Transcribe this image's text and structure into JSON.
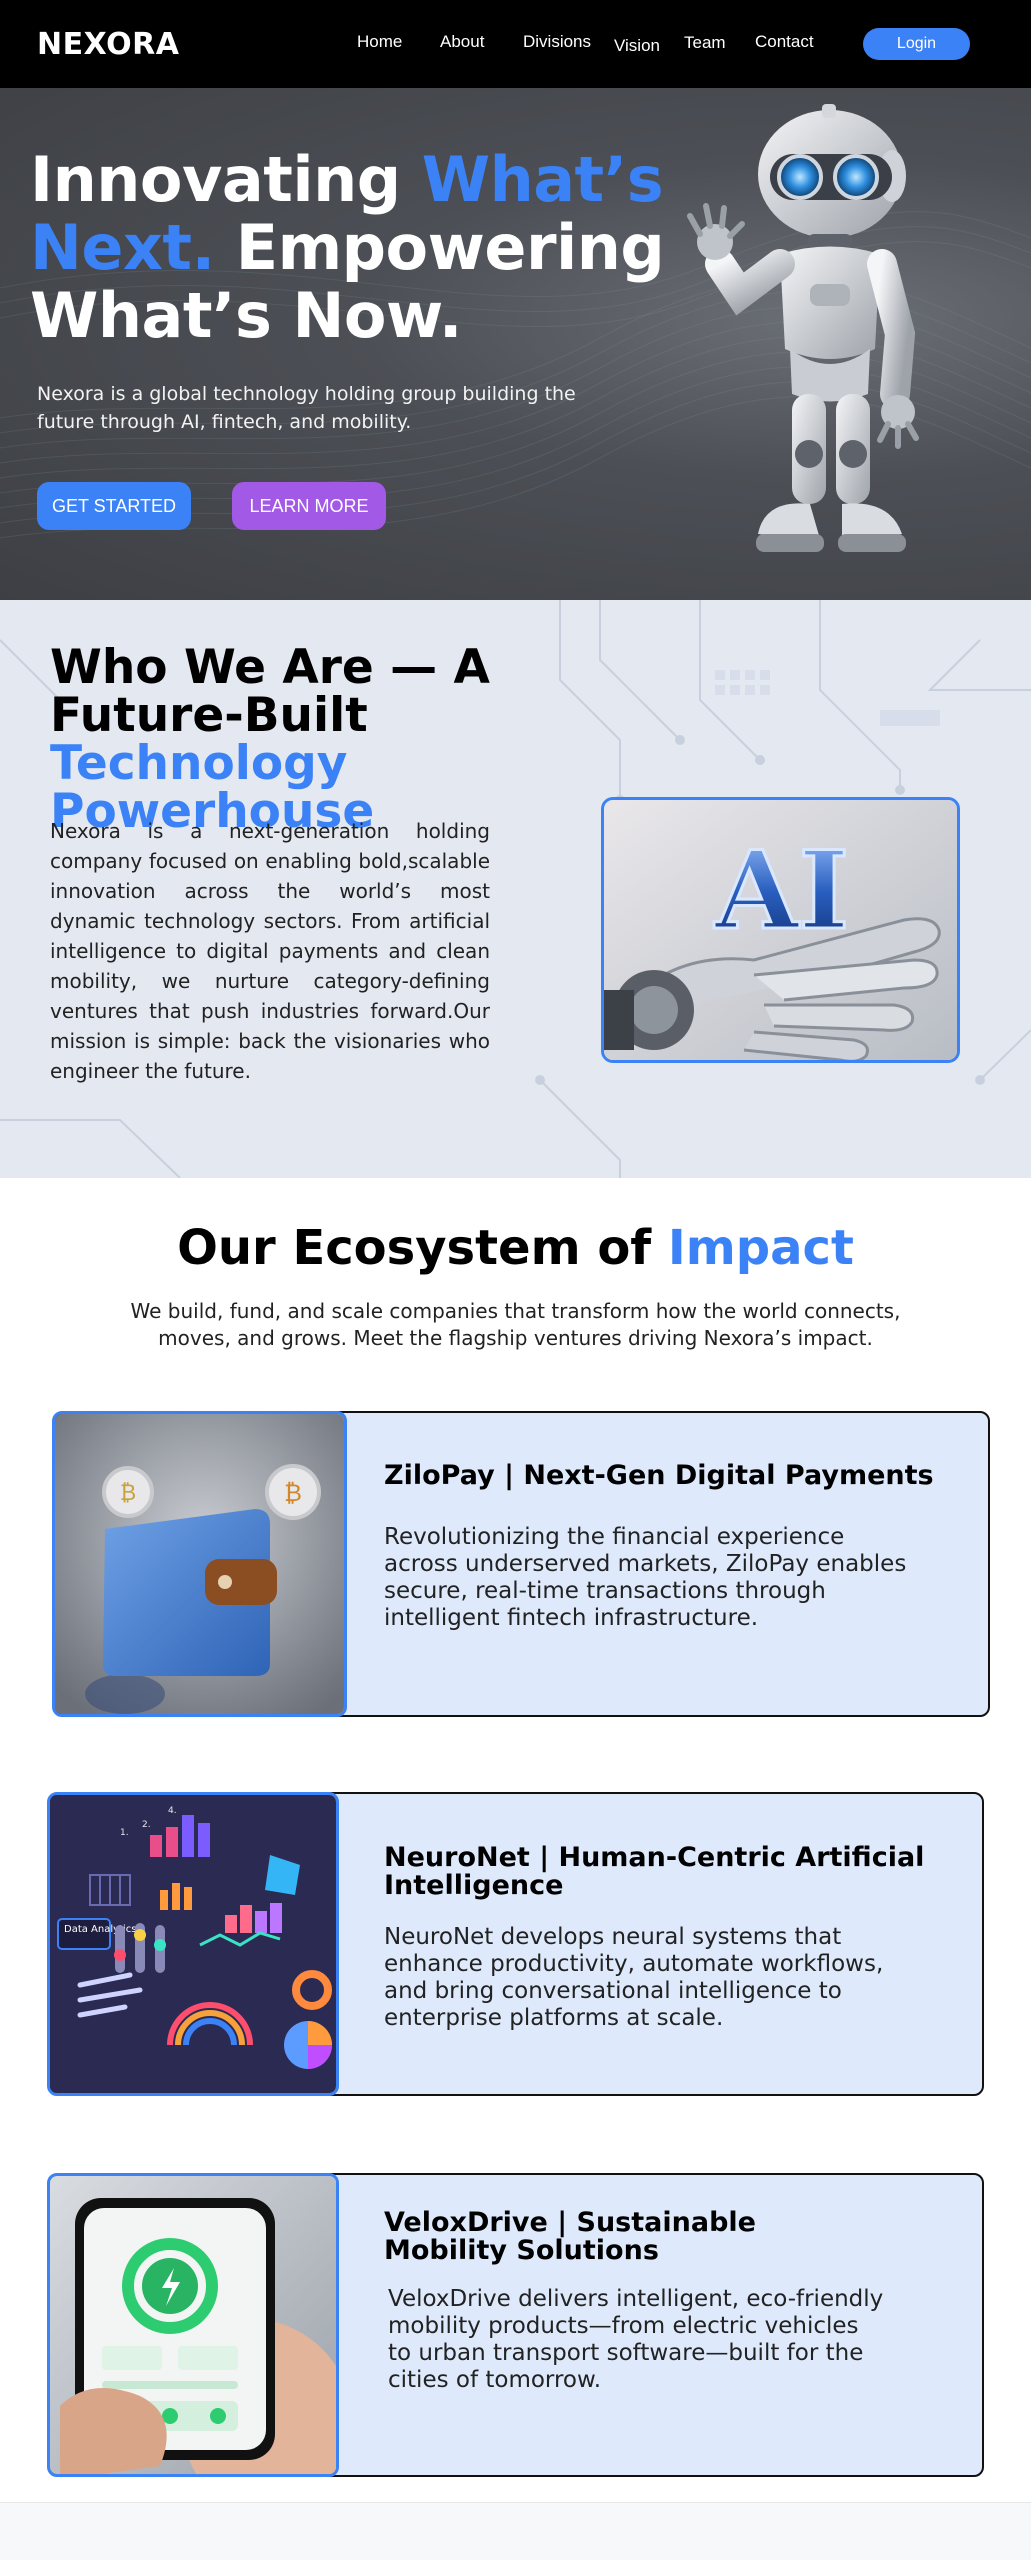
{
  "nav": {
    "logo": "NEXORA",
    "items": [
      "Home",
      "About",
      "Divisions",
      "Vision",
      "Team",
      "Contact"
    ],
    "login": "Login"
  },
  "hero": {
    "title_1": "Innovating ",
    "title_2": "What’s",
    "title_3": "Next.",
    "title_4": " Empowering",
    "title_5": "What’s Now.",
    "subtitle": "Nexora is a global technology holding group building the future through AI, fintech, and mobility.",
    "cta_primary": "GET STARTED",
    "cta_secondary": "LEARN MORE"
  },
  "who": {
    "title_1": "Who We Are — A Future-Built ",
    "title_2": "Technology Powerhouse",
    "body": "Nexora is a next-generation holding company focused on enabling bold,scalable innovation across the world’s most dynamic technology sectors. From artificial intelligence to digital payments and clean mobility, we nurture category-defining ventures that push industries forward.Our mission  is simple: back the visionaries who engineer the future.",
    "image_text": "AI"
  },
  "ecosystem": {
    "title_1": "Our Ecosystem of ",
    "title_2": "Impact",
    "subtitle": "We build, fund, and scale companies that transform how the world connects, moves, and grows. Meet the flagship ventures driving Nexora’s impact.",
    "cards": [
      {
        "title": "ZiloPay | Next-Gen Digital Payments",
        "text": "Revolutionizing the financial experience across underserved markets, ZiloPay enables secure, real-time transactions through intelligent fintech infrastructure."
      },
      {
        "title": "NeuroNet | Human-Centric Artificial Intelligence",
        "text": "NeuroNet develops neural systems that enhance productivity, automate workflows, and bring conversational intelligence to enterprise platforms at scale."
      },
      {
        "title": "VeloxDrive | Sustainable Mobility Solutions",
        "text": "VeloxDrive delivers intelligent, eco-friendly mobility products—from electric vehicles to urban transport software—built for the cities of tomorrow."
      }
    ],
    "analytics_label": "Data Analytics"
  },
  "colors": {
    "accent": "#3b82f6",
    "secondary": "#a259e6",
    "card_bg": "#deeafc"
  }
}
